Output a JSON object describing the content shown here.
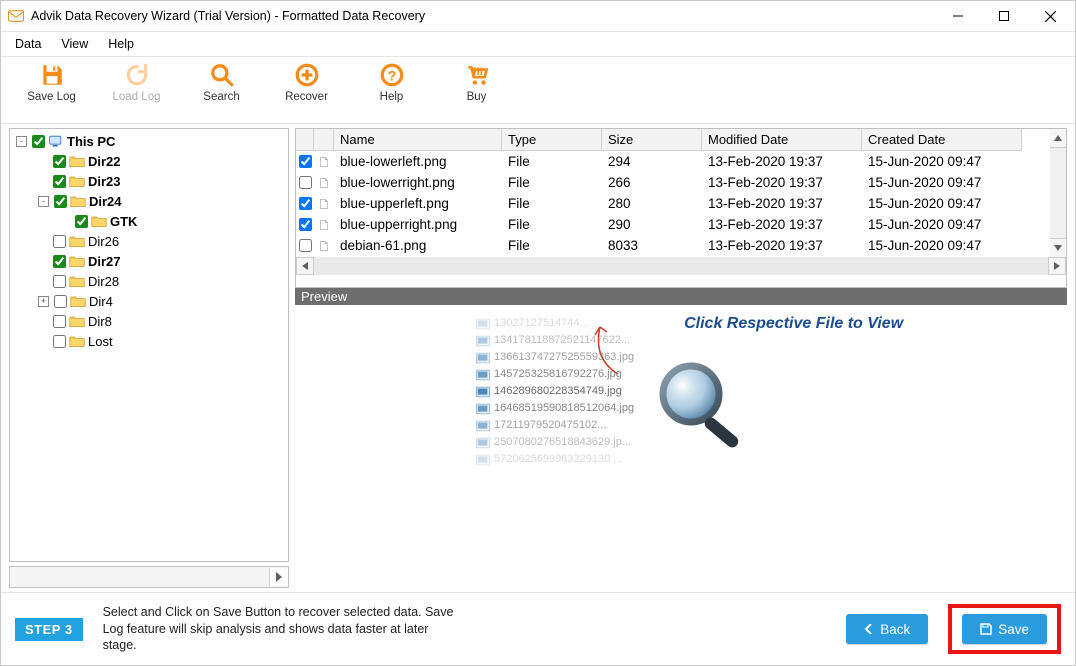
{
  "window": {
    "title": "Advik Data Recovery Wizard (Trial Version) - Formatted Data Recovery"
  },
  "menu": {
    "items": [
      "Data",
      "View",
      "Help"
    ]
  },
  "toolbar": {
    "save_log": "Save Log",
    "load_log": "Load Log",
    "search": "Search",
    "recover": "Recover",
    "help": "Help",
    "buy": "Buy"
  },
  "tree": {
    "root": {
      "label": "This PC",
      "checked": true,
      "expanded": true
    },
    "children": [
      {
        "label": "Dir22",
        "bold": true,
        "checked": true,
        "toggle": ""
      },
      {
        "label": "Dir23",
        "bold": true,
        "checked": true,
        "toggle": ""
      },
      {
        "label": "Dir24",
        "bold": true,
        "checked": true,
        "toggle": "-",
        "children": [
          {
            "label": "GTK",
            "bold": true,
            "checked": true,
            "toggle": ""
          }
        ]
      },
      {
        "label": "Dir26",
        "bold": false,
        "checked": false,
        "toggle": ""
      },
      {
        "label": "Dir27",
        "bold": true,
        "checked": true,
        "toggle": ""
      },
      {
        "label": "Dir28",
        "bold": false,
        "checked": false,
        "toggle": ""
      },
      {
        "label": "Dir4",
        "bold": false,
        "checked": false,
        "toggle": "+"
      },
      {
        "label": "Dir8",
        "bold": false,
        "checked": false,
        "toggle": ""
      },
      {
        "label": "Lost",
        "bold": false,
        "checked": false,
        "toggle": ""
      }
    ]
  },
  "grid": {
    "columns": [
      "Name",
      "Type",
      "Size",
      "Modified Date",
      "Created Date"
    ],
    "rows": [
      {
        "checked": true,
        "name": "blue-lowerleft.png",
        "type": "File",
        "size": "294",
        "modified": "13-Feb-2020 19:37",
        "created": "15-Jun-2020 09:47"
      },
      {
        "checked": false,
        "name": "blue-lowerright.png",
        "type": "File",
        "size": "266",
        "modified": "13-Feb-2020 19:37",
        "created": "15-Jun-2020 09:47"
      },
      {
        "checked": true,
        "name": "blue-upperleft.png",
        "type": "File",
        "size": "280",
        "modified": "13-Feb-2020 19:37",
        "created": "15-Jun-2020 09:47"
      },
      {
        "checked": true,
        "name": "blue-upperright.png",
        "type": "File",
        "size": "290",
        "modified": "13-Feb-2020 19:37",
        "created": "15-Jun-2020 09:47"
      },
      {
        "checked": false,
        "name": "debian-61.png",
        "type": "File",
        "size": "8033",
        "modified": "13-Feb-2020 19:37",
        "created": "15-Jun-2020 09:47"
      }
    ]
  },
  "preview": {
    "header": "Preview",
    "hint": "Click Respective File to View",
    "sample_lines": [
      "13027127514744...",
      "134178118872521147622...",
      "1366137472752555936​3.jpg",
      "14572532581679​2276.jpg",
      "1462896802283547​49.jpg",
      "16468519590818512​064.jpg",
      "1721197952047510​2...",
      "25070802765188436​29.jp...",
      "5720625699983229130 ..."
    ]
  },
  "footer": {
    "step_label": "STEP 3",
    "tip": "Select and Click on Save Button to recover selected data. Save Log feature will skip analysis and shows data faster at later stage.",
    "back_label": "Back",
    "save_label": "Save"
  }
}
